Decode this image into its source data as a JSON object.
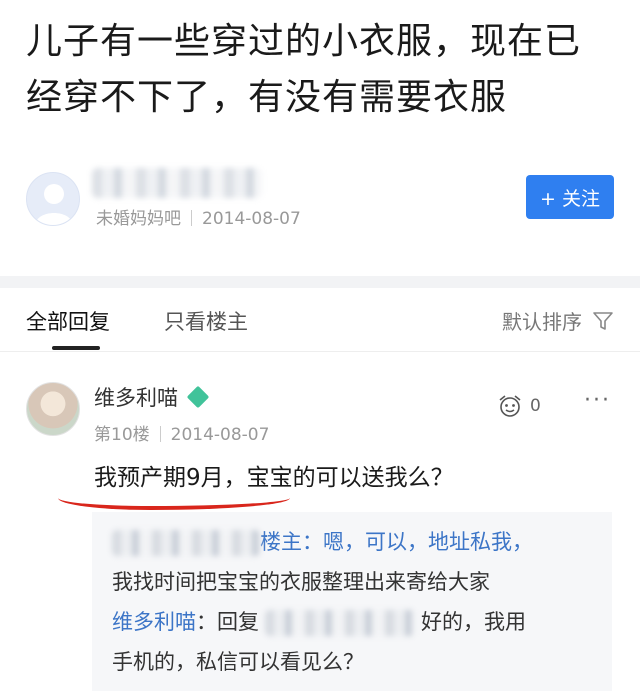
{
  "post": {
    "title": "儿子有一些穿过的小衣服，现在已经穿不下了，有没有需要衣服"
  },
  "author": {
    "forum": "未婚妈妈吧",
    "date": "2014-08-07",
    "follow_label": "+ 关注"
  },
  "tabs": {
    "all": "全部回复",
    "owner_only": "只看楼主",
    "sort_label": "默认排序"
  },
  "reply": {
    "name": "维多利喵",
    "floor": "第10楼",
    "date": "2014-08-07",
    "like_count": "0",
    "more": "···",
    "text": "我预产期9月，宝宝的可以送我么？"
  },
  "sub_replies": {
    "line1_tail": "楼主：嗯，可以，地址私我，",
    "line2": "我找时间把宝宝的衣服整理出来寄给大家",
    "line3_name": "维多利喵",
    "line3_mid": "：回复",
    "line3_tail": "好的，我用",
    "line4": "手机的，私信可以看见么？"
  },
  "colors": {
    "accent": "#2f7ff0",
    "highlight_underline": "#d9261c",
    "username_blue": "#3c75c7"
  }
}
